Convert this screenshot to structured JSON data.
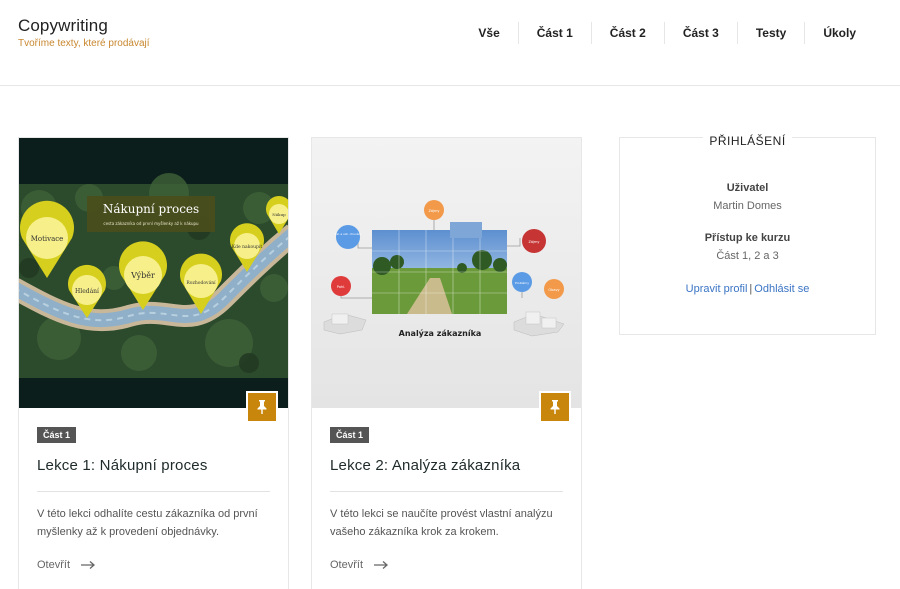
{
  "brand": {
    "title": "Copywriting",
    "tagline": "Tvoříme texty, které prodávají"
  },
  "nav": [
    {
      "label": "Vše"
    },
    {
      "label": "Část 1"
    },
    {
      "label": "Část 2"
    },
    {
      "label": "Část 3"
    },
    {
      "label": "Testy"
    },
    {
      "label": "Úkoly"
    }
  ],
  "colors": {
    "accent": "#c8860d",
    "tagline": "#c8872f",
    "link": "#3a74c4",
    "tag_bg": "#555555"
  },
  "cards": [
    {
      "tag": "Část 1",
      "title": "Lekce 1: Nákupní proces",
      "description": "V této lekci odhalíte cestu zákazníka od první myšlenky až k provedení objednávky.",
      "link": "Otevřít",
      "image": {
        "heading": "Nákupní proces",
        "subheading": "cesta zákazníka od první myšlenky až k nákupu",
        "pins": [
          "Motivace",
          "Hledání",
          "Výběr",
          "Rozhodování",
          "Kde nakoupit",
          "Nákup"
        ]
      }
    },
    {
      "tag": "Část 1",
      "title": "Lekce 2: Analýza zákazníka",
      "description": "V této lekci se naučíte provést vlastní analýzu vašeho zákazníka krok za krokem.",
      "link": "Otevřít",
      "image": {
        "caption": "Analýza zákazníka",
        "bubbles": [
          "Bio a ost. chování",
          "Pohl.",
          "Zájmy",
          "Zájmy",
          "Problémy",
          "Obavy"
        ]
      }
    }
  ],
  "login": {
    "title": "PŘIHLÁŠENÍ",
    "user_label": "Uživatel",
    "user_value": "Martin Domes",
    "access_label": "Přístup ke kurzu",
    "access_value": "Část 1, 2 a 3",
    "edit_profile": "Upravit profil",
    "separator": "|",
    "logout": "Odhlásit se"
  }
}
